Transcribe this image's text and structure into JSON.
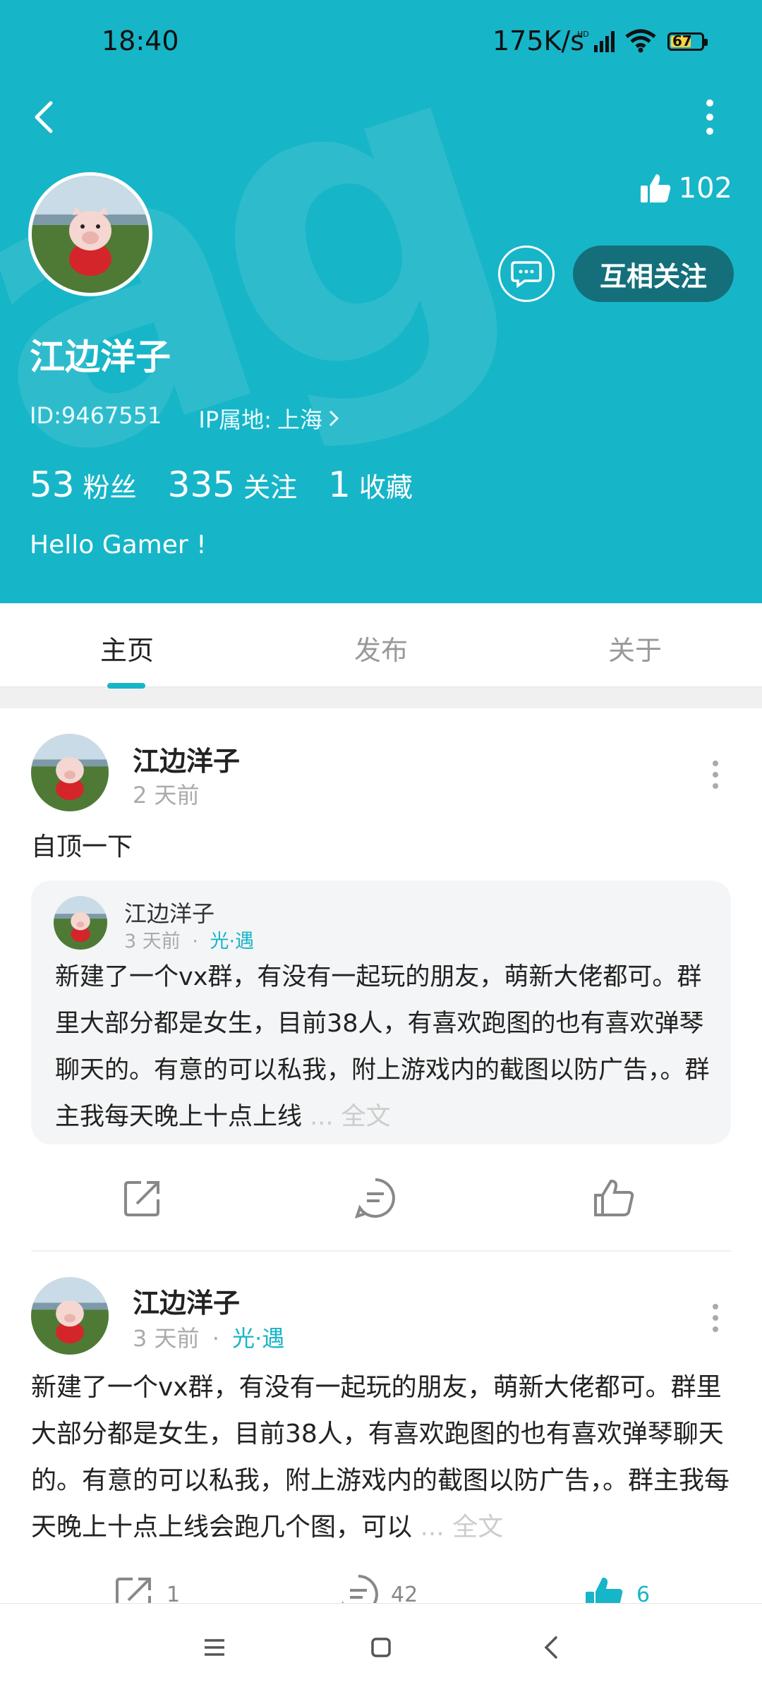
{
  "status_bar": {
    "time": "18:40",
    "network_speed": "175K/s",
    "network_type": "HD",
    "battery_level": "67",
    "battery_fraction": 0.67
  },
  "profile": {
    "username": "江边洋子",
    "id_text": "ID:9467551",
    "ip_label": "IP属地:",
    "ip_location": "上海",
    "likes": "102",
    "follow_label": "互相关注",
    "stats": [
      {
        "value": "53",
        "label": "粉丝"
      },
      {
        "value": "335",
        "label": "关注"
      },
      {
        "value": "1",
        "label": "收藏"
      }
    ],
    "bio": "Hello Gamer !"
  },
  "tabs": [
    {
      "label": "主页",
      "active": true
    },
    {
      "label": "发布",
      "active": false
    },
    {
      "label": "关于",
      "active": false
    }
  ],
  "posts": [
    {
      "author": "江边洋子",
      "time": "2 天前",
      "text": "自顶一下",
      "quote": {
        "author": "江边洋子",
        "time": "3 天前",
        "separator": "·",
        "location": "光·遇",
        "text": "新建了一个vx群，有没有一起玩的朋友，萌新大佬都可。群里大部分都是女生，目前38人，有喜欢跑图的也有喜欢弹琴聊天的。有意的可以私我，附上游戏内的截图以防广告，。群主我每天晚上十点上线",
        "more": "... 全文"
      }
    },
    {
      "author": "江边洋子",
      "time": "3 天前",
      "separator": "·",
      "location": "光·遇",
      "text": "新建了一个vx群，有没有一起玩的朋友，萌新大佬都可。群里大部分都是女生，目前38人，有喜欢跑图的也有喜欢弹琴聊天的。有意的可以私我，附上游戏内的截图以防广告，。群主我每天晚上十点上线会跑几个图，可以",
      "more": "... 全文",
      "share_count": "1",
      "comment_count": "42",
      "like_count": "6"
    }
  ],
  "colors": {
    "accent": "#17b5c8",
    "follow_button": "#146f7b",
    "liked": "#17b5c8"
  },
  "icons": [
    "back-icon",
    "more-icon",
    "thumb-up-icon",
    "message-icon",
    "chevron-right-icon",
    "share-icon",
    "comment-icon",
    "menu-icon",
    "home-icon",
    "nav-back-icon"
  ]
}
